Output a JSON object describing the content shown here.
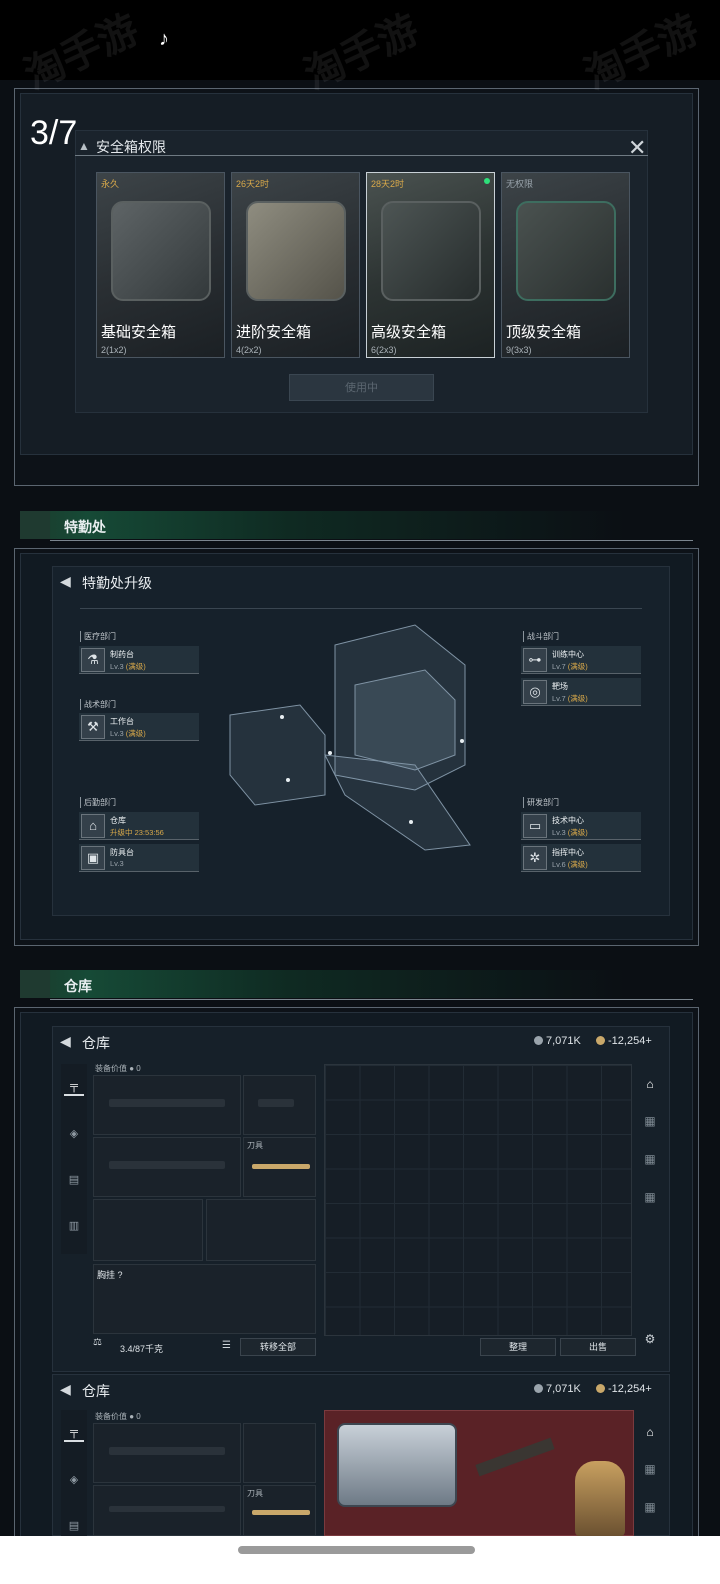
{
  "page_counter": "3/7",
  "safe_box": {
    "title": "安全箱权限",
    "close_icon": "close-icon",
    "cards": [
      {
        "tag": "永久",
        "tag_color": "#d9a94a",
        "name": "基础安全箱",
        "size": "2(1x2)"
      },
      {
        "tag": "26天2时",
        "tag_color": "#d9a94a",
        "name": "进阶安全箱",
        "size": "4(2x2)"
      },
      {
        "tag": "28天2时",
        "tag_color": "#d9a94a",
        "name": "高级安全箱",
        "size": "6(2x3)"
      },
      {
        "tag": "无权限",
        "tag_color": "#9aa4ac",
        "name": "顶级安全箱",
        "size": "9(3x3)"
      }
    ],
    "button": "使用中"
  },
  "sections": {
    "agency": "特勤处",
    "warehouse": "仓库"
  },
  "agency": {
    "title": "特勤处升级",
    "departments": {
      "medical": "医疗部门",
      "tactical": "战术部门",
      "logistics": "后勤部门",
      "combat": "战斗部门",
      "rnd": "研发部门"
    },
    "facilities": {
      "pharmacy": {
        "name": "制药台",
        "level": "Lv.3",
        "status": "(满级)"
      },
      "workbench": {
        "name": "工作台",
        "level": "Lv.3",
        "status": "(满级)"
      },
      "storage": {
        "name": "仓库",
        "level": "升级中",
        "status": "23:53:56"
      },
      "defense": {
        "name": "防具台",
        "level": "Lv.3",
        "status": ""
      },
      "training": {
        "name": "训练中心",
        "level": "Lv.7",
        "status": "(满级)"
      },
      "range": {
        "name": "靶场",
        "level": "Lv.7",
        "status": "(满级)"
      },
      "tech": {
        "name": "技术中心",
        "level": "Lv.3",
        "status": "(满级)"
      },
      "ops": {
        "name": "指挥中心",
        "level": "Lv.6",
        "status": "(满级)"
      }
    }
  },
  "warehouse": {
    "title": "仓库",
    "currency1": "7,071K",
    "currency2": "-12,254",
    "plus": "+",
    "equip_value_label": "装备价值",
    "equip_value": "0",
    "chest_label": "胸挂",
    "chest_hint": "?",
    "weight": "3.4/87千克",
    "transfer_all": "转移全部",
    "sort": "整理",
    "sell": "出售",
    "melee_label": "刀具"
  },
  "colors": {
    "accent_green": "#1f6a4a",
    "gold": "#d9a94a"
  }
}
